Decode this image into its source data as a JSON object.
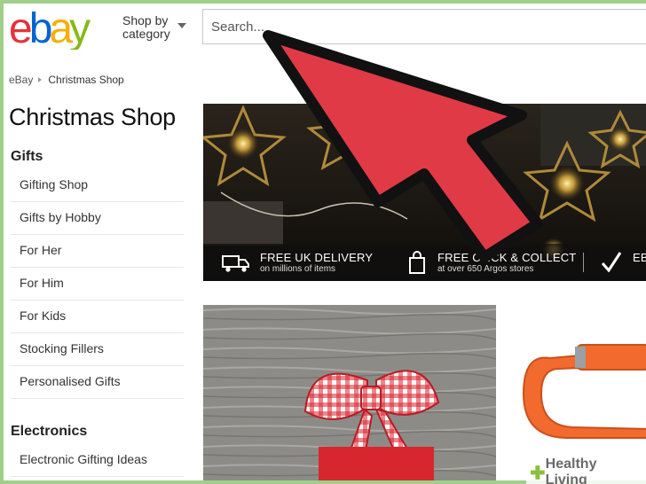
{
  "header": {
    "logo": {
      "letters": [
        "e",
        "b",
        "a",
        "y"
      ],
      "colors": [
        "#e53238",
        "#0064d2",
        "#f5af02",
        "#86b817"
      ]
    },
    "shop_by_line1": "Shop by",
    "shop_by_line2": "category",
    "search_placeholder": "Search..."
  },
  "breadcrumb": {
    "root": "eBay",
    "current": "Christmas Shop"
  },
  "sidebar": {
    "page_title": "Christmas Shop",
    "gifts_heading": "Gifts",
    "gifts_items": [
      "Gifting Shop",
      "Gifts by Hobby",
      "For Her",
      "For Him",
      "For Kids",
      "Stocking Fillers",
      "Personalised Gifts"
    ],
    "electronics_heading": "Electronics",
    "electronics_items": [
      "Electronic Gifting Ideas"
    ]
  },
  "hero": {
    "features": [
      {
        "title": "FREE UK DELIVERY",
        "subtitle": "on millions of items",
        "icon": "delivery-truck-icon"
      },
      {
        "title": "FREE CLICK & COLLECT",
        "subtitle": "at over 650 Argos stores",
        "icon": "shopping-bag-icon"
      },
      {
        "title": "EB",
        "subtitle": "",
        "icon": "checkmark-icon"
      }
    ]
  },
  "overlay": {
    "arrow_color": "#e03a46",
    "arrow_outline": "#111111"
  },
  "watermark": {
    "text": "Healthy Living"
  }
}
